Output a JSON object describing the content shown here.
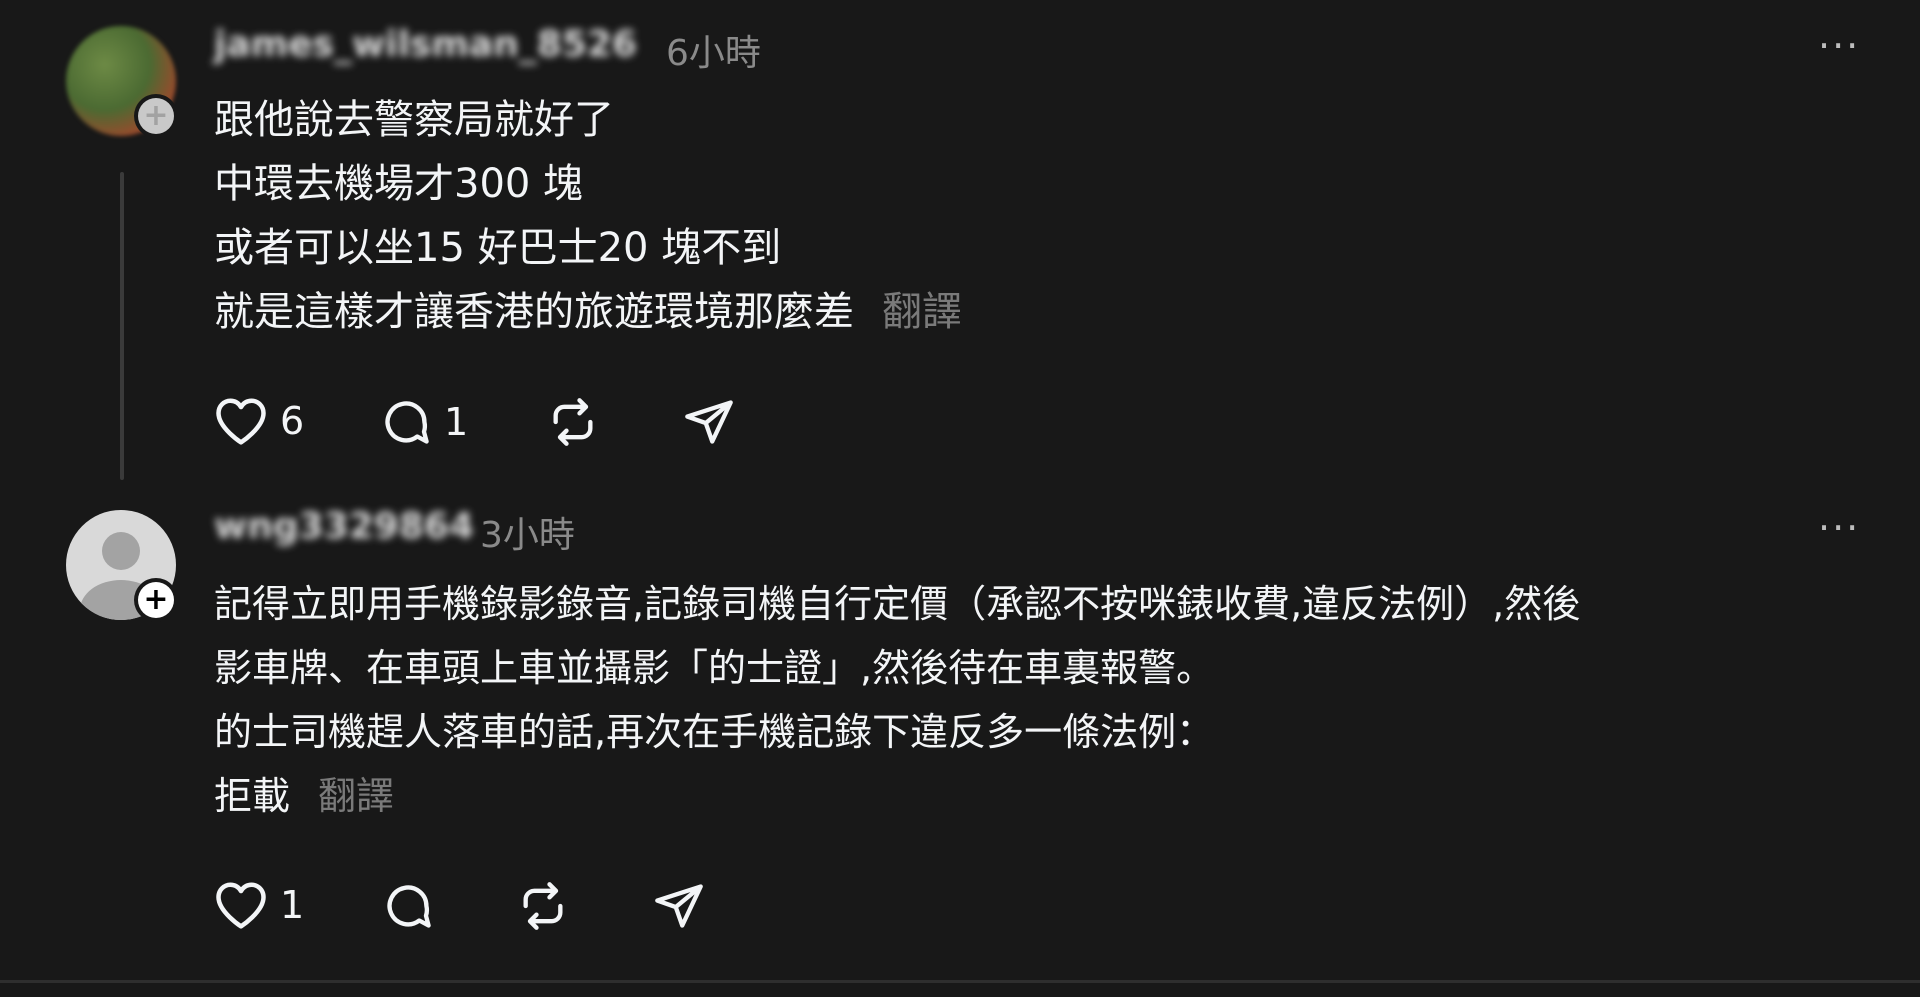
{
  "posts": [
    {
      "username": "james_wilsman_8526",
      "time": "6小時",
      "lines": [
        "跟他說去警察局就好了",
        "中環去機場才300 塊",
        "或者可以坐15 好巴士20 塊不到",
        "就是這樣才讓香港的旅遊環境那麼差"
      ],
      "translate": "翻譯",
      "likes": "6",
      "replies": "1",
      "more": "···"
    },
    {
      "username": "wng3329864",
      "time": "3小時",
      "lines": [
        "記得立即用手機錄影錄音,記錄司機自行定價（承認不按咪錶收費,違反法例）,然後",
        "影車牌、在車頭上車並攝影「的士證」,然後待在車裏報警。",
        "的士司機趕人落車的話,再次在手機記錄下違反多一條法例：",
        "拒載"
      ],
      "translate": "翻譯",
      "likes": "1",
      "more": "···"
    }
  ],
  "icons": {
    "like": "heart-icon",
    "reply": "comment-icon",
    "repost": "repost-icon",
    "share": "send-icon",
    "more": "more-icon",
    "follow": "plus-icon"
  }
}
